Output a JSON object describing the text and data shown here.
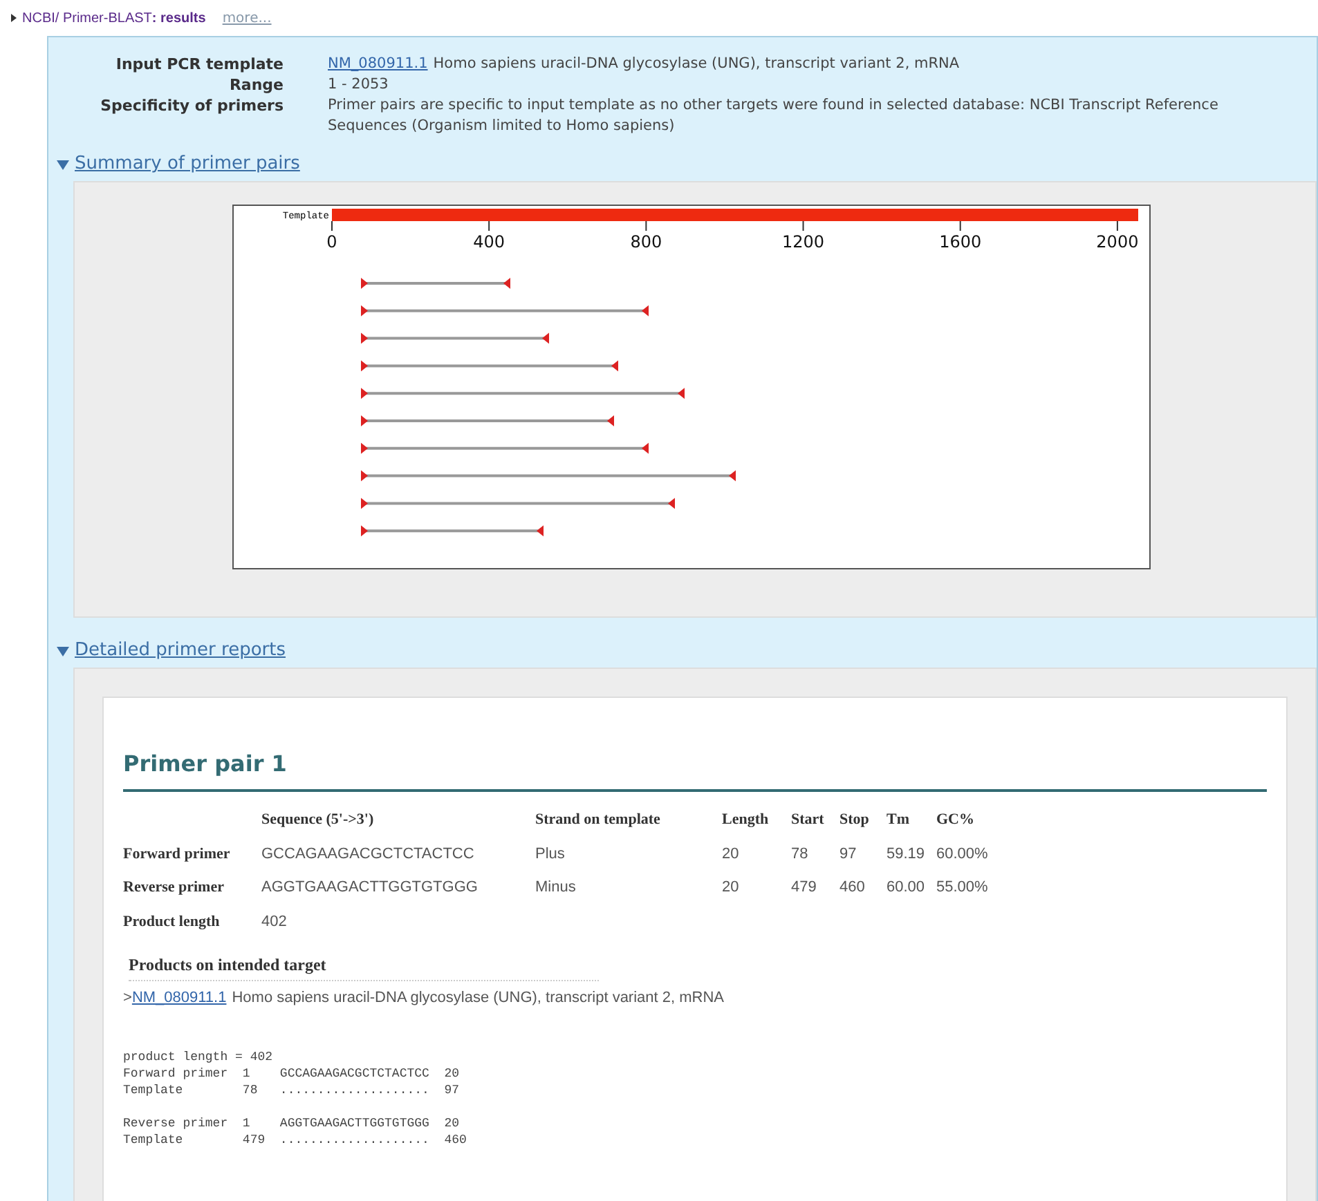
{
  "breadcrumb": {
    "path": "NCBI/ Primer-BLAST",
    "separator": ":",
    "page": "results",
    "more_link": "more..."
  },
  "summary_fields": [
    {
      "label": "Input PCR template",
      "link": "NM_080911.1",
      "value": "Homo sapiens uracil-DNA glycosylase (UNG), transcript variant 2, mRNA"
    },
    {
      "label": "Range",
      "value": "1 - 2053"
    },
    {
      "label": "Specificity of primers",
      "value": "Primer pairs are specific to input template as no other targets were found in selected database: NCBI Transcript Reference Sequences (Organism limited to Homo sapiens)"
    }
  ],
  "sections": [
    {
      "title": "Summary of primer pairs",
      "expanded": true
    },
    {
      "title": "Detailed primer reports",
      "expanded": true
    }
  ],
  "primer_map": {
    "template_label": "Template",
    "axis_ticks": [
      "0",
      "400",
      "800",
      "1200",
      "1600",
      "2000"
    ]
  },
  "report": {
    "title": "Primer pair 1",
    "columns": [
      "",
      "Sequence (5'->3')",
      "Strand on template",
      "Length",
      "Start",
      "Stop",
      "Tm",
      "GC%"
    ],
    "rows": [
      [
        "Forward primer",
        "GCCAGAAGACGCTCTACTCC",
        "Plus",
        "20",
        "78",
        "97",
        "59.19",
        "60.00%"
      ],
      [
        "Reverse primer",
        "AGGTGAAGACTTGGTGTGGG",
        "Minus",
        "20",
        "479",
        "460",
        "60.00",
        "55.00%"
      ],
      [
        "Product length",
        "402"
      ]
    ],
    "products_heading": "Products on intended target",
    "product": {
      "prefix": ">",
      "link": "NM_080911.1",
      "description": "Homo sapiens uracil-DNA glycosylase (UNG), transcript variant 2, mRNA"
    },
    "alignment": [
      [
        "product length = 402",
        "Forward primer  1    GCCAGAAGACGCTCTACTCC  20",
        "Template        78   ....................  97"
      ],
      [
        "Reverse primer  1    AGGTGAAGACTTGGTGTGGG  20",
        "Template        479  ....................  460"
      ]
    ]
  }
}
